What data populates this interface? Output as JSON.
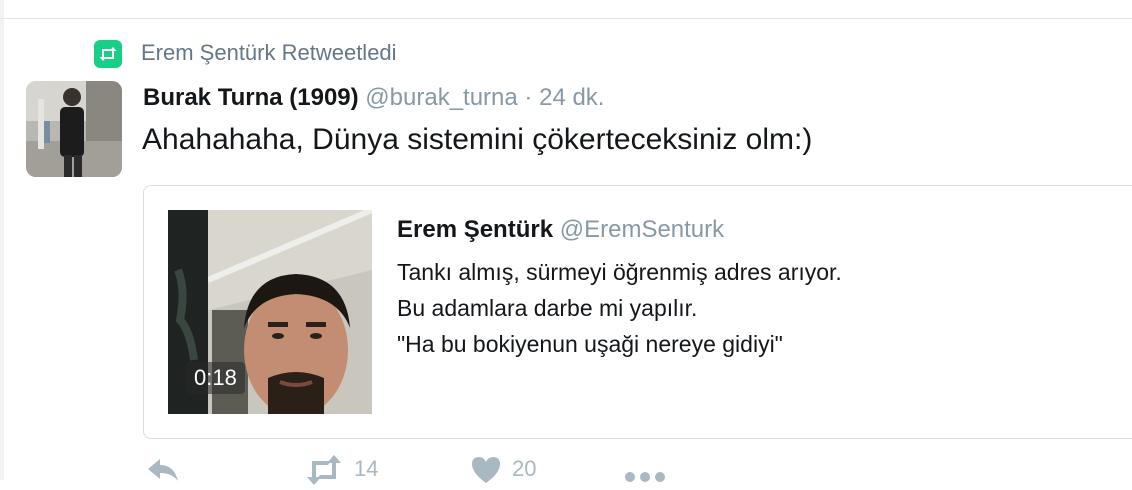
{
  "retweet": {
    "text": "Erem Şentürk Retweetledi",
    "icon": "retweet-icon",
    "color": "#19cf86"
  },
  "tweet": {
    "author_name": "Burak Turna (1909)",
    "author_handle": "@burak_turna",
    "separator": "·",
    "time": "24 dk.",
    "text": "Ahahahaha, Dünya sistemini çökerteceksiniz olm:)"
  },
  "quote": {
    "author_name": "Erem Şentürk",
    "author_handle": "@EremSenturk",
    "lines": [
      "Tankı almış, sürmeyi öğrenmiş adres arıyor.",
      "Bu adamlara darbe mi yapılır.",
      "\"Ha bu bokiyenun uşaği nereye gidiyi\""
    ],
    "video_duration": "0:18"
  },
  "actions": {
    "reply_icon": "reply-icon",
    "retweet_count": "14",
    "like_count": "20",
    "more_icon": "more-icon"
  },
  "colors": {
    "muted": "#8899a6",
    "text": "#14171a",
    "border": "#e1e8ed"
  }
}
